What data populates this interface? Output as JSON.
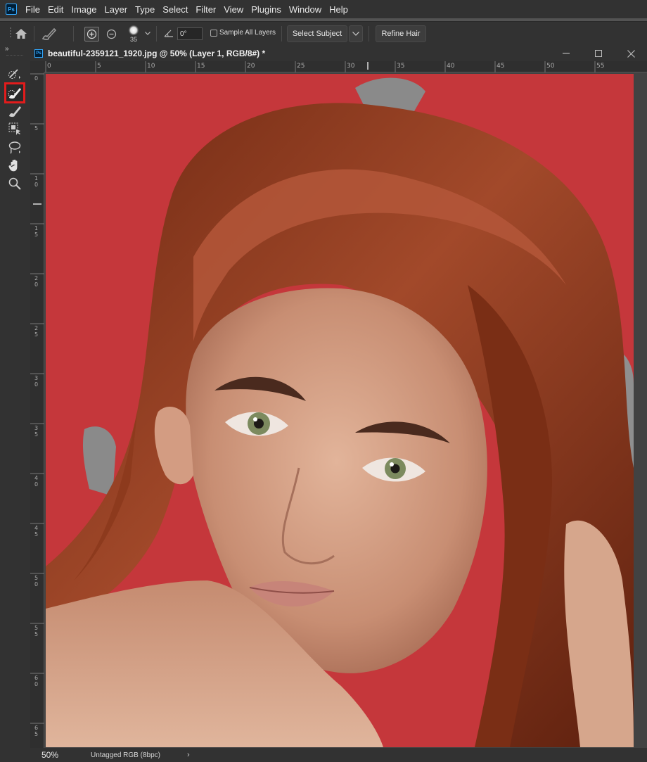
{
  "menu": {
    "logo": "Ps",
    "items": [
      "File",
      "Edit",
      "Image",
      "Layer",
      "Type",
      "Select",
      "Filter",
      "View",
      "Plugins",
      "Window",
      "Help"
    ]
  },
  "options": {
    "brush_size": "35",
    "angle": "0°",
    "sample_all_layers": "Sample All Layers",
    "select_subject": "Select Subject",
    "refine_hair": "Refine Hair"
  },
  "toolbar": {
    "collapse": "»",
    "tools": [
      "quick-selection-icon",
      "quick-mask-brush-icon",
      "brush-icon",
      "object-selection-icon",
      "lasso-icon",
      "hand-icon",
      "zoom-icon"
    ],
    "active_index": 1
  },
  "document": {
    "logo": "Ps",
    "title": "beautiful-2359121_1920.jpg @ 50% (Layer 1, RGB/8#) *",
    "ruler_top": [
      "0",
      "5",
      "10",
      "15",
      "20",
      "25",
      "30",
      "35",
      "40",
      "45",
      "50",
      "55"
    ],
    "ruler_left": [
      "0",
      "5",
      "10",
      "15",
      "20",
      "25",
      "30",
      "35",
      "40",
      "45",
      "50",
      "55",
      "60",
      "65"
    ],
    "colors": {
      "overlay_red": "#c5373b",
      "skin": "#d9a58a",
      "hair": "#8a3a1c"
    }
  },
  "status": {
    "zoom": "50%",
    "profile": "Untagged RGB (8bpc)",
    "arrow": "›"
  }
}
